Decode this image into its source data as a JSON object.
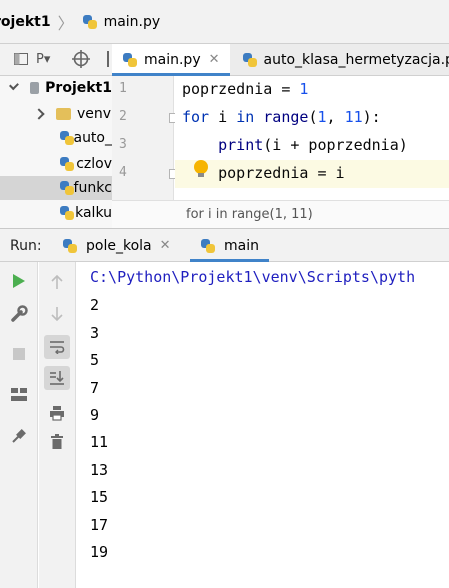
{
  "breadcrumb": {
    "project": "rojekt1",
    "file": "main.py"
  },
  "project_panel": {
    "title": "P▾",
    "root": "Projekt1",
    "items": [
      "venv",
      "auto_",
      "czlov",
      "funkc",
      "kalku"
    ]
  },
  "editor_tabs": [
    {
      "label": "main.py",
      "close": "✕"
    },
    {
      "label": "auto_klasa_hermetyzacja.py"
    }
  ],
  "editor": {
    "line_numbers": [
      "1",
      "2",
      "3",
      "4"
    ],
    "lines": [
      {
        "t1": "poprzednia = ",
        "t2": "1"
      },
      {
        "t1": "for",
        "t2": " i ",
        "t3": "in",
        "t4": " range",
        "t5": "(",
        "t6": "1",
        "t7": ", ",
        "t8": "11",
        "t9": "):"
      },
      {
        "t1": "    print",
        "t2": "(i + poprzednia)"
      },
      {
        "t1": "    poprzednia = i"
      }
    ],
    "breadcrumb_hint": "for i in range(1, 11)"
  },
  "run": {
    "label": "Run:",
    "tabs": [
      {
        "label": "pole_kola",
        "close": "✕"
      },
      {
        "label": "main"
      }
    ],
    "console": [
      "C:\\Python\\Projekt1\\venv\\Scripts\\pyth",
      "2",
      "3",
      "5",
      "7",
      "9",
      "11",
      "13",
      "15",
      "17",
      "19"
    ]
  },
  "colors": {
    "accent": "#4083c9",
    "keyword": "#0033b3",
    "number": "#1750eb",
    "run_green": "#4caf50"
  }
}
